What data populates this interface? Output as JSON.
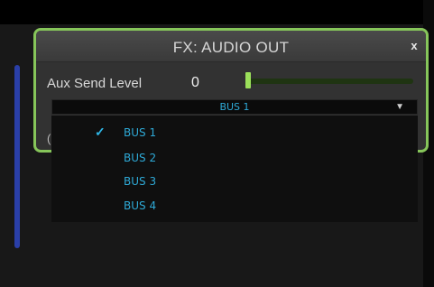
{
  "window": {
    "title": "FX: AUDIO OUT",
    "close_label": "x"
  },
  "aux_send": {
    "label": "Aux Send Level",
    "value": "0",
    "slider_fraction": 0.0
  },
  "panel_partial_text": "(",
  "bus_select": {
    "selected": "BUS 1",
    "arrow_icon": "triangle-down-icon",
    "options": [
      {
        "label": "BUS 1",
        "checked": true
      },
      {
        "label": "BUS 2",
        "checked": false
      },
      {
        "label": "BUS 3",
        "checked": false
      },
      {
        "label": "BUS 4",
        "checked": false
      }
    ],
    "check_mark": "✓"
  },
  "colors": {
    "panel_border": "#86c55a",
    "accent_text": "#2ea9d6",
    "slider_fill": "#9be05a",
    "side_strip": "#2a3fa8"
  }
}
